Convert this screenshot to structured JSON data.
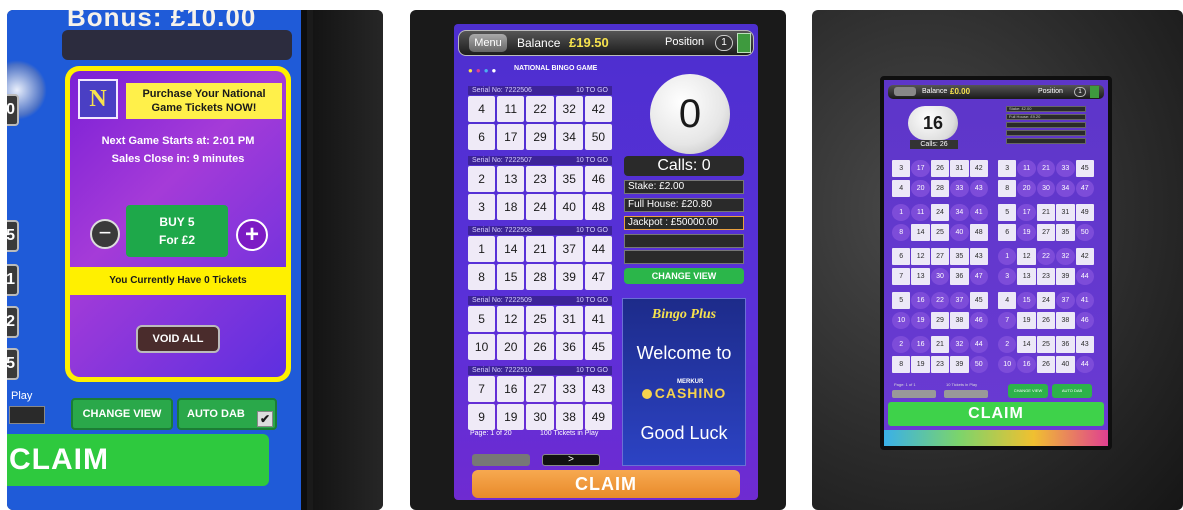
{
  "photo1": {
    "bonus_text": "Bonus: £10.00",
    "side_buttons": [
      "0",
      "5",
      "1",
      "2",
      "5"
    ],
    "logo_letter": "N",
    "purchase_text": "Purchase Your National Game Tickets NOW!",
    "next_game": "Next Game Starts at: 2:01 PM",
    "sales_close": "Sales Close in: 9 minutes",
    "buy_label_line1": "BUY 5",
    "buy_label_line2": "For £2",
    "minus_glyph": "−",
    "plus_glyph": "+",
    "tickets_have": "You Currently Have 0 Tickets",
    "void_all": "VOID ALL",
    "play_label": "Play",
    "change_view": "CHANGE VIEW",
    "auto_dab": "AUTO DAB",
    "check_glyph": "✔",
    "claim": "CLAIM"
  },
  "photo2": {
    "menu": "Menu",
    "balance_label": "Balance",
    "balance_value": "£19.50",
    "position_label": "Position",
    "position_value": "1",
    "game_title": "NATIONAL BINGO GAME",
    "tickets": [
      {
        "serial": "Serial No: 7222506",
        "togo": "10 TO GO",
        "numbers": [
          "4",
          "11",
          "22",
          "32",
          "42",
          "6",
          "17",
          "29",
          "34",
          "50"
        ]
      },
      {
        "serial": "Serial No: 7222507",
        "togo": "10 TO GO",
        "numbers": [
          "2",
          "13",
          "23",
          "35",
          "46",
          "3",
          "18",
          "24",
          "40",
          "48"
        ]
      },
      {
        "serial": "Serial No: 7222508",
        "togo": "10 TO GO",
        "numbers": [
          "1",
          "14",
          "21",
          "37",
          "44",
          "8",
          "15",
          "28",
          "39",
          "47"
        ]
      },
      {
        "serial": "Serial No: 7222509",
        "togo": "10 TO GO",
        "numbers": [
          "5",
          "12",
          "25",
          "31",
          "41",
          "10",
          "20",
          "26",
          "36",
          "45"
        ]
      },
      {
        "serial": "Serial No: 7222510",
        "togo": "10 TO GO",
        "numbers": [
          "7",
          "16",
          "27",
          "33",
          "43",
          "9",
          "19",
          "30",
          "38",
          "49"
        ]
      }
    ],
    "ball_number": "0",
    "calls": "Calls: 0",
    "stake": "Stake: £2.00",
    "full_house": "Full House: £20.80",
    "jackpot": "Jackpot : £50000.00",
    "change_view": "CHANGE VIEW",
    "promo_title": "Bingo Plus",
    "welcome": "Welcome to",
    "merkur": "MERKUR",
    "cashino": "CASHINO",
    "good_luck": "Good Luck",
    "page_label": "Page: 1 of 20",
    "tickets_in_play": "100 Tickets in Play",
    "next_glyph": ">",
    "claim": "CLAIM"
  },
  "photo3": {
    "balance_label": "Balance",
    "balance_value": "£0.00",
    "position_label": "Position",
    "position_value": "1",
    "ball_number": "16",
    "calls": "Calls: 26",
    "right_info": [
      "Stake: £2.00",
      "Full House: £9.20"
    ],
    "tickets": [
      {
        "numbers": [
          "3",
          "17",
          "26",
          "31",
          "42",
          "4",
          "20",
          "28",
          "33",
          "43"
        ],
        "dabbed": [
          1,
          6,
          8,
          9
        ]
      },
      {
        "numbers": [
          "3",
          "11",
          "21",
          "33",
          "45",
          "8",
          "20",
          "30",
          "34",
          "47"
        ],
        "dabbed": [
          1,
          2,
          3,
          6,
          7,
          8,
          9
        ]
      },
      {
        "numbers": [
          "1",
          "11",
          "24",
          "34",
          "41",
          "8",
          "14",
          "25",
          "40",
          "48"
        ],
        "dabbed": [
          0,
          1,
          3,
          4,
          5,
          8
        ]
      },
      {
        "numbers": [
          "5",
          "17",
          "21",
          "31",
          "49",
          "6",
          "19",
          "27",
          "35",
          "50"
        ],
        "dabbed": [
          1,
          6,
          9
        ]
      },
      {
        "numbers": [
          "6",
          "12",
          "27",
          "35",
          "43",
          "7",
          "13",
          "30",
          "36",
          "47"
        ],
        "dabbed": [
          7,
          9
        ]
      },
      {
        "numbers": [
          "1",
          "12",
          "22",
          "32",
          "42",
          "3",
          "13",
          "23",
          "39",
          "44"
        ],
        "dabbed": [
          0,
          2,
          3,
          5,
          9
        ]
      },
      {
        "numbers": [
          "5",
          "16",
          "22",
          "37",
          "45",
          "10",
          "19",
          "29",
          "38",
          "46"
        ],
        "dabbed": [
          1,
          2,
          3,
          5,
          6,
          9
        ]
      },
      {
        "numbers": [
          "4",
          "15",
          "24",
          "37",
          "41",
          "7",
          "19",
          "26",
          "38",
          "46"
        ],
        "dabbed": [
          1,
          3,
          4,
          5,
          9
        ]
      },
      {
        "numbers": [
          "2",
          "16",
          "21",
          "32",
          "44",
          "8",
          "19",
          "23",
          "39",
          "50"
        ],
        "dabbed": [
          0,
          1,
          3,
          4,
          9
        ]
      },
      {
        "numbers": [
          "2",
          "14",
          "25",
          "36",
          "43",
          "10",
          "16",
          "26",
          "40",
          "44"
        ],
        "dabbed": [
          0,
          5,
          6,
          9
        ]
      }
    ],
    "page_label": "Page: 1 of 1",
    "tickets_in_play": "10 Tickets in Play",
    "change_view": "CHANGE VIEW",
    "auto_dab": "AUTO DAB",
    "claim": "CLAIM"
  }
}
